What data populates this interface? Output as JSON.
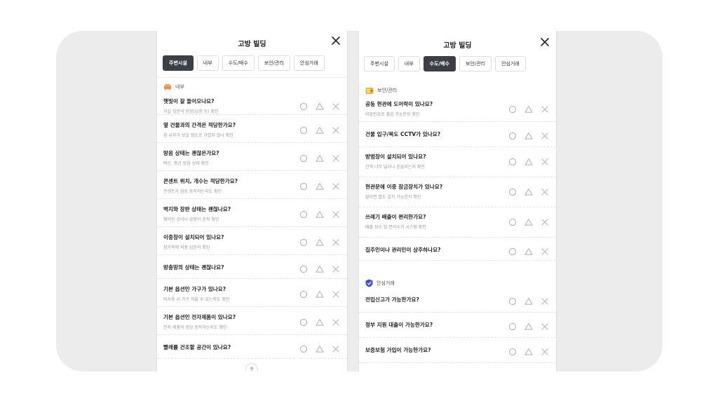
{
  "left": {
    "title": "고방 빌딩",
    "tabs": [
      {
        "label": "주변시설",
        "active": true
      },
      {
        "label": "내부",
        "active": false
      },
      {
        "label": "수도/배수",
        "active": false
      },
      {
        "label": "보안/관리",
        "active": false
      },
      {
        "label": "안심거래",
        "active": false
      }
    ],
    "section_label": "내부",
    "section_icon": "sofa-icon",
    "items": [
      {
        "q": "햇빛이 잘 들어오나요?",
        "sub": "거실 창문의 방향(남향 등) 확인"
      },
      {
        "q": "옆 건물과의 간격은 적당한가요?",
        "sub": "집 내부가 보일 정도로 가깝지 않나 확인"
      },
      {
        "q": "방음 상태는 괜찮은가요?",
        "sub": "벽간, 층간 방음 상태 확인"
      },
      {
        "q": "콘센트 위치, 개수는 적당한가요?",
        "sub": "콘센트가 정상 동작하는지도 확인"
      },
      {
        "q": "벽지와 장판 상태는 괜찮나요?",
        "sub": "찢어진 곳이나 곰팡이 흔적 확인"
      },
      {
        "q": "이중창이 설치되어 있나요?",
        "sub": "창가쪽에 외풍 심한지 확인"
      },
      {
        "q": "방충망의 상태는 괜찮나요?",
        "sub": ""
      },
      {
        "q": "기본 옵션인 가구가 있나요?",
        "sub": "미사용 시 가구 치울 수 있는지도 확인"
      },
      {
        "q": "기본 옵션인 전자제품이 있나요?",
        "sub": "전자 제품이 정상 동작하는지도 확인"
      },
      {
        "q": "빨래를 건조할 공간이 있나요?",
        "sub": ""
      }
    ]
  },
  "right": {
    "title": "고방 빌딩",
    "tabs": [
      {
        "label": "주변시설",
        "active": false
      },
      {
        "label": "내부",
        "active": false
      },
      {
        "label": "수도/배수",
        "active": true
      },
      {
        "label": "보안/관리",
        "active": false
      },
      {
        "label": "안심거래",
        "active": false
      }
    ],
    "section1_label": "보안/관리",
    "section1_icon": "safe-icon",
    "items1": [
      {
        "q": "공동 현관에 도어락이 있나요?",
        "sub": "비밀번호로 출입 가능한지 확인"
      },
      {
        "q": "건물 입구/복도 CCTV가 있나요?",
        "sub": ""
      },
      {
        "q": "방범창이 설치되어 있나요?",
        "sub": "간격 너무 넓거나 흔들리는지 확인"
      },
      {
        "q": "현관문에 이중 잠금장치가 있나요?",
        "sub": "없다면 별도 설치 가능한지 확인"
      },
      {
        "q": "쓰레기 배출이 편리한가요?",
        "sub": "배출 장소 및 분리수거 시스템 확인"
      },
      {
        "q": "집주인이나 관리인이 상주하나요?",
        "sub": ""
      }
    ],
    "section2_label": "안심거래",
    "section2_icon": "shield-check-icon",
    "items2": [
      {
        "q": "전입신고가 가능한가요?",
        "sub": ""
      },
      {
        "q": "정부 지원 대출이 가능한가요?",
        "sub": ""
      },
      {
        "q": "보증보험 가입이 가능한가요?",
        "sub": ""
      }
    ]
  },
  "colors": {
    "active_tab": "#3c3f45",
    "option_gray": "#b5b5b5",
    "stage_bg": "#ececec"
  }
}
